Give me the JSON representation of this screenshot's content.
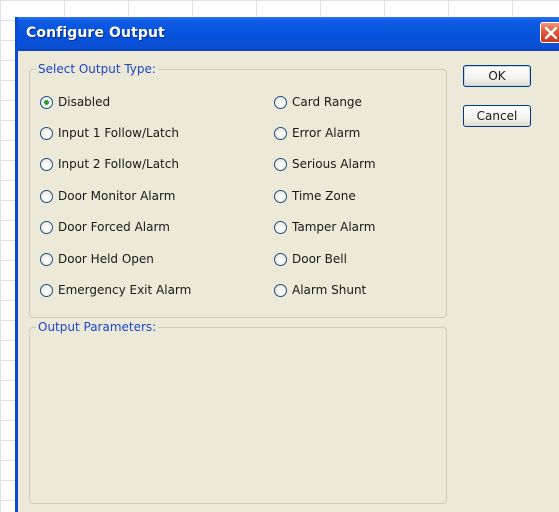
{
  "dialog": {
    "title": "Configure Output",
    "close_icon": "close-icon",
    "colors": {
      "titlebar": "#0553dc",
      "body": "#ece9d8",
      "legend_text": "#1e46c2",
      "close_button": "#e2583a",
      "selected_dot": "#2b9b2b"
    }
  },
  "output_type": {
    "legend": "Select Output Type:",
    "selected": "Disabled",
    "options_left": [
      {
        "label": "Disabled",
        "checked": true
      },
      {
        "label": "Input 1 Follow/Latch",
        "checked": false
      },
      {
        "label": "Input 2 Follow/Latch",
        "checked": false
      },
      {
        "label": "Door Monitor Alarm",
        "checked": false
      },
      {
        "label": "Door Forced Alarm",
        "checked": false
      },
      {
        "label": "Door Held Open",
        "checked": false
      },
      {
        "label": "Emergency Exit Alarm",
        "checked": false
      }
    ],
    "options_right": [
      {
        "label": "Card Range",
        "checked": false
      },
      {
        "label": "Error Alarm",
        "checked": false
      },
      {
        "label": "Serious Alarm",
        "checked": false
      },
      {
        "label": "Time Zone",
        "checked": false
      },
      {
        "label": "Tamper Alarm",
        "checked": false
      },
      {
        "label": "Door Bell",
        "checked": false
      },
      {
        "label": "Alarm Shunt",
        "checked": false
      }
    ]
  },
  "output_parameters": {
    "legend": "Output Parameters:"
  },
  "buttons": {
    "ok": "OK",
    "cancel": "Cancel"
  }
}
